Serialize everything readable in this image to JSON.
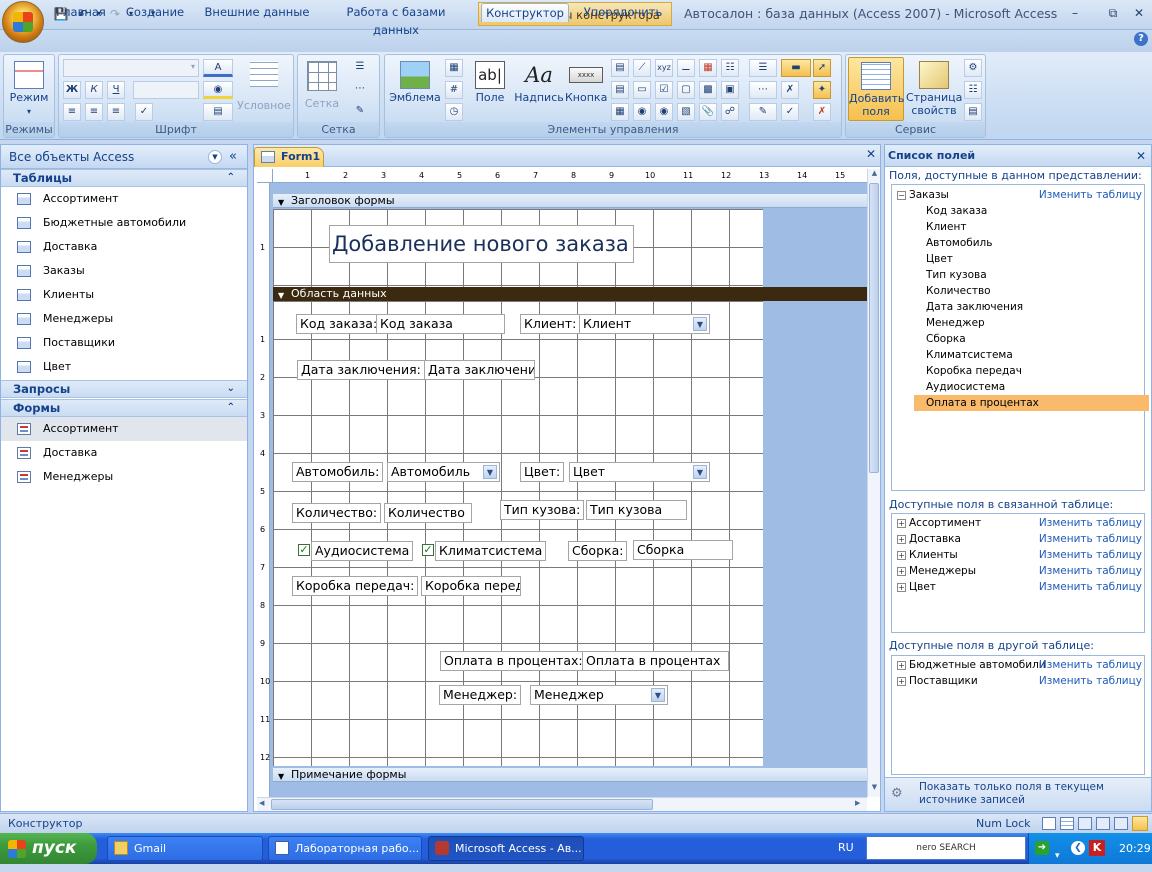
{
  "window": {
    "title": "Автосалон : база данных (Access 2007) - Microsoft Access",
    "contextual_tab": "Инструменты конструктора форм"
  },
  "ribbon_tabs": [
    "Главная",
    "Создание",
    "Внешние данные",
    "Работа с базами данных",
    "Конструктор",
    "Упорядочить"
  ],
  "ribbon": {
    "groups": {
      "views": "Режимы",
      "font": "Шрифт",
      "grid": "Сетка",
      "controls": "Элементы управления",
      "tools": "Сервис"
    },
    "buttons": {
      "view": "Режим",
      "conditional": "Условное",
      "grid": "Сетка",
      "logo": "Эмблема",
      "field": "Поле",
      "label": "Надпись",
      "button": "Кнопка",
      "add_fields": "Добавить поля",
      "props": "Страница свойств"
    },
    "font_buttons": {
      "bold": "Ж",
      "italic": "К",
      "underline": "Ч"
    },
    "button_caption": "xxxx"
  },
  "nav": {
    "header": "Все объекты Access",
    "sections": [
      {
        "title": "Таблицы",
        "items": [
          "Ассортимент",
          "Бюджетные автомобили",
          "Доставка",
          "Заказы",
          "Клиенты",
          "Менеджеры",
          "Поставщики",
          "Цвет"
        ]
      },
      {
        "title": "Запросы",
        "items": []
      },
      {
        "title": "Формы",
        "items": [
          "Ассортимент",
          "Доставка",
          "Менеджеры"
        ]
      }
    ],
    "selected_form": "Ассортимент"
  },
  "designer": {
    "tab": "Form1",
    "sections": {
      "header": "Заголовок формы",
      "detail": "Область данных",
      "footer": "Примечание формы"
    },
    "form_title": "Добавление нового заказа",
    "ruler_h": [
      "1",
      "2",
      "3",
      "4",
      "5",
      "6",
      "7",
      "8",
      "9",
      "10",
      "11",
      "12",
      "13",
      "14",
      "15"
    ],
    "ruler_v": [
      "1",
      "1",
      "2",
      "3",
      "4",
      "5",
      "6",
      "7",
      "8",
      "9",
      "10",
      "11",
      "12"
    ],
    "controls": {
      "order_id_label": "Код заказа:",
      "order_id": "Код заказа",
      "client_label": "Клиент:",
      "client": "Клиент",
      "date_label": "Дата заключения:",
      "date": "Дата заключени",
      "car_label": "Автомобиль:",
      "car": "Автомобиль",
      "color_label": "Цвет:",
      "color": "Цвет",
      "qty_label": "Количество:",
      "qty": "Количество",
      "body_label": "Тип кузова:",
      "body": "Тип кузова",
      "audio_label": "Аудиосистема",
      "climate_label": "Климатсистема",
      "assembly_label": "Сборка:",
      "assembly": "Сборка",
      "gearbox_label": "Коробка передач:",
      "gearbox": "Коробка перед",
      "payment_label": "Оплата в процентах:",
      "payment": "Оплата в процентах",
      "manager_label": "Менеджер:",
      "manager": "Менеджер"
    }
  },
  "fieldlist": {
    "title": "Список полей",
    "available_caption": "Поля, доступные в данном представлении:",
    "table": "Заказы",
    "edit_link": "Изменить таблицу",
    "fields": [
      "Код заказа",
      "Клиент",
      "Автомобиль",
      "Цвет",
      "Тип кузова",
      "Количество",
      "Дата заключения",
      "Менеджер",
      "Сборка",
      "Климатсистема",
      "Коробка передач",
      "Аудиосистема",
      "Оплата в процентах"
    ],
    "selected_field": "Оплата в процентах",
    "related_caption": "Доступные поля в связанной таблице:",
    "related": [
      "Ассортимент",
      "Доставка",
      "Клиенты",
      "Менеджеры",
      "Цвет"
    ],
    "other_caption": "Доступные поля в другой таблице:",
    "other": [
      "Бюджетные автомобили",
      "Поставщики"
    ],
    "show_only": "Показать только поля в текущем источнике записей"
  },
  "status": {
    "mode": "Конструктор",
    "numlock": "Num Lock"
  },
  "taskbar": {
    "start": "пуск",
    "tasks": [
      "Gmail",
      "Лабораторная рабо...",
      "Microsoft Access - Ав..."
    ],
    "lang": "RU",
    "search": "nero SEARCH",
    "time": "20:29"
  },
  "colors": {
    "ribbon": "#c7dbf2",
    "context": "#edc76f",
    "selected": "#f9ba6c",
    "taskbar": "#245edb"
  }
}
